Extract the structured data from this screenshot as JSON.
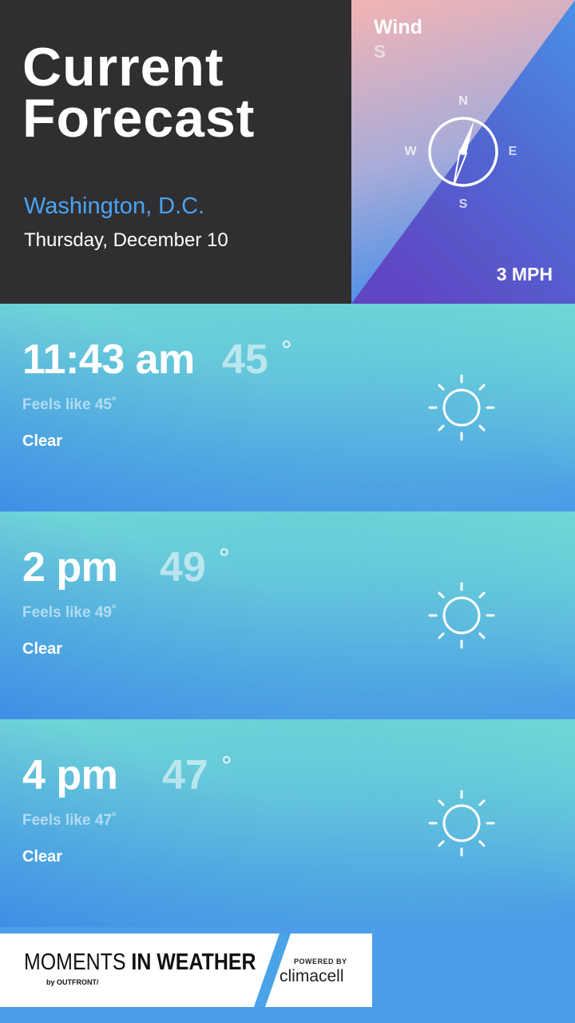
{
  "header": {
    "title_line1": "Current",
    "title_line2": "Forecast",
    "city": "Washington, D.C.",
    "date": "Thursday, December 10"
  },
  "wind": {
    "label": "Wind",
    "direction": "S",
    "speed": "3 MPH",
    "compass": {
      "n": "N",
      "e": "E",
      "s": "S",
      "w": "W"
    },
    "colors": {
      "pink": "#f2b4b4",
      "blue": "#4a8fe8",
      "purple": "#5a4fc8"
    }
  },
  "forecasts": [
    {
      "time": "11:43 am",
      "temp": "45",
      "degree": "°",
      "feels": "Feels like 45˚",
      "condition": "Clear",
      "icon": "sun-icon"
    },
    {
      "time": "2 pm",
      "temp": "49",
      "degree": "°",
      "feels": "Feels like 49˚",
      "condition": "Clear",
      "icon": "sun-icon"
    },
    {
      "time": "4 pm",
      "temp": "47",
      "degree": "°",
      "feels": "Feels like 47˚",
      "condition": "Clear",
      "icon": "sun-icon"
    }
  ],
  "footer": {
    "brand_light": "MOMENTS ",
    "brand_bold": "IN WEATHER",
    "brand_by": "by OUTFRONT/",
    "powered_by": "POWERED BY",
    "partner": "climacell"
  }
}
